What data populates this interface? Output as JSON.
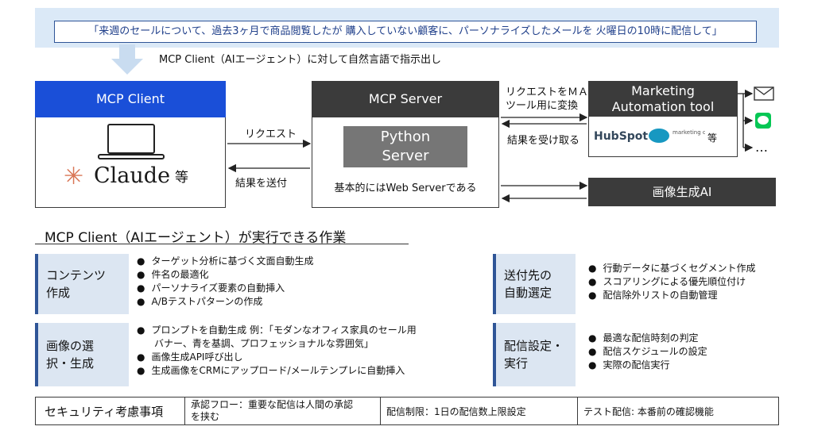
{
  "prompt": "「来週のセールについて、過去3ヶ月で商品閲覧したが 購入していない顧客に、パーソナライズしたメールを 火曜日の10時に配信して」",
  "instruction": "MCP Client（AIエージェント）に対して自然言語で指示出し",
  "client": {
    "header": "MCP Client",
    "brand": "Claude",
    "etc": "等"
  },
  "server": {
    "header": "MCP Server",
    "python_line1": "Python",
    "python_line2": "Server",
    "note": "基本的にはWeb Serverである"
  },
  "edges": {
    "request": "リクエスト",
    "send_result": "結果を送付",
    "convert_line1": "リクエストをＭＡ",
    "convert_line2": "ツール用に変換",
    "receive_result": "結果を受け取る"
  },
  "ma": {
    "header_line1": "Marketing",
    "header_line2": "Automation tool",
    "hubspot": "HubSpot",
    "sf_cloud": "marketing cloud",
    "etc": "等"
  },
  "ai": {
    "label": "画像生成AI"
  },
  "channels": {
    "more": "…"
  },
  "section_title": "MCP Client（AIエージェント）が実行できる作業",
  "tasks": [
    {
      "label_line1": "コンテンツ",
      "label_line2": "作成",
      "items": [
        "ターゲット分析に基づく文面自動生成",
        "件名の最適化",
        "パーソナライズ要素の自動挿入",
        "A/Bテストパターンの作成"
      ]
    },
    {
      "label_line1": "画像の選",
      "label_line2": "択・生成",
      "items": [
        "プロンプトを自動生成 例：「モダンなオフィス家具のセール用",
        "バナー、青を基調、プロフェッショナルな雰囲気」",
        "画像生成API呼び出し",
        "生成画像をCRMにアップロード/メールテンプレに自動挿入"
      ]
    },
    {
      "label_line1": "送付先の",
      "label_line2": "自動選定",
      "items": [
        "行動データに基づくセグメント作成",
        "スコアリングによる優先順位付け",
        "配信除外リストの自動管理"
      ]
    },
    {
      "label_line1": "配信設定・",
      "label_line2": "実行",
      "items": [
        "最適な配信時刻の判定",
        "配信スケジュールの設定",
        "実際の配信実行"
      ]
    }
  ],
  "security": {
    "title": "セキュリティ考慮事項",
    "item1_line1": "承認フロー：重要な配信は人間の承認",
    "item1_line2": "を挟む",
    "item2": "配信制限：1日の配信数上限設定",
    "item3": "テスト配信: 本番前の確認機能"
  }
}
